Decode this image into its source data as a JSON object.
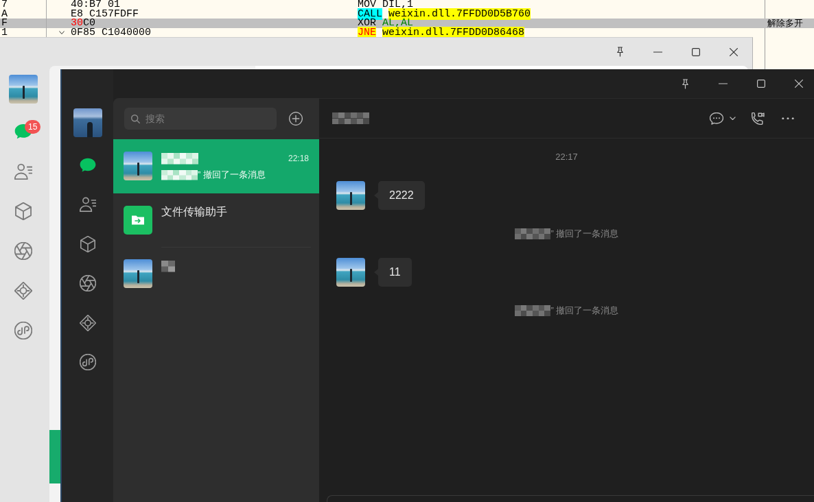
{
  "debugger": {
    "rows": [
      {
        "marker": "7",
        "jump_arrow": false,
        "bytes": [
          {
            "text": "40:B7 01",
            "kind": "plain"
          }
        ],
        "instruction": [
          {
            "text": "MOV",
            "kind": "plain"
          },
          {
            "text": "DIL,1",
            "kind": "plain"
          }
        ],
        "selected": false
      },
      {
        "marker": "A",
        "jump_arrow": false,
        "bytes": [
          {
            "text": "E8 C157FDFF",
            "kind": "plain"
          }
        ],
        "instruction": [
          {
            "text": "CALL",
            "kind": "call"
          },
          {
            "text": "weixin.dll.7FFDD0D5B760",
            "kind": "target"
          }
        ],
        "selected": false
      },
      {
        "marker": "F",
        "jump_arrow": false,
        "bytes": [
          {
            "text": "30",
            "kind": "patched"
          },
          {
            "text": "C0",
            "kind": "plain"
          }
        ],
        "instruction": [
          {
            "text": "XOR",
            "kind": "plain"
          },
          {
            "text": "AL,AL",
            "kind": "register"
          }
        ],
        "comment": "解除多开",
        "selected": true
      },
      {
        "marker": "1",
        "jump_arrow": true,
        "bytes": [
          {
            "text": "0F85 C1040000",
            "kind": "plain"
          }
        ],
        "instruction": [
          {
            "text": "JNE",
            "kind": "jump"
          },
          {
            "text": "weixin.dll.7FFDD0D86468",
            "kind": "target"
          }
        ],
        "selected": false
      }
    ]
  },
  "back_window": {
    "sidebar": {
      "items": [
        {
          "kind": "bubble",
          "selected": true,
          "badge": "15"
        },
        {
          "kind": "people",
          "selected": false
        },
        {
          "kind": "cube",
          "selected": false
        },
        {
          "kind": "aperture",
          "selected": false
        },
        {
          "kind": "diamond",
          "selected": false
        },
        {
          "kind": "loop",
          "selected": false
        }
      ]
    },
    "chat_list": {
      "rows": [
        {
          "selected": true
        }
      ]
    }
  },
  "window": {
    "sidebar": {
      "items": [
        {
          "kind": "bubble",
          "selected": true
        },
        {
          "kind": "people",
          "selected": false
        },
        {
          "kind": "cube",
          "selected": false
        },
        {
          "kind": "aperture",
          "selected": false
        },
        {
          "kind": "diamond",
          "selected": false
        },
        {
          "kind": "loop",
          "selected": false
        }
      ]
    },
    "chat_list": {
      "search": {
        "placeholder": "搜索"
      },
      "rows": [
        {
          "kind": "photo",
          "name_blurred": true,
          "time": "22:18",
          "preview_blurred": true,
          "preview": "” 撤回了一条消息",
          "selected": true
        },
        {
          "kind": "transfer",
          "name_blurred": false,
          "name": "文件传输助手",
          "selected": false
        },
        {
          "kind": "photo",
          "name_blurred": true,
          "selected": false
        }
      ]
    },
    "chat": {
      "title_blurred": true,
      "messages": [
        {
          "kind": "time",
          "text": "22:17"
        },
        {
          "kind": "text",
          "text": "2222"
        },
        {
          "kind": "recall",
          "name_blurred": true,
          "text": "” 撤回了一条消息"
        },
        {
          "kind": "text",
          "text": "11"
        },
        {
          "kind": "recall",
          "name_blurred": true,
          "text": "” 撤回了一条消息"
        }
      ]
    }
  }
}
